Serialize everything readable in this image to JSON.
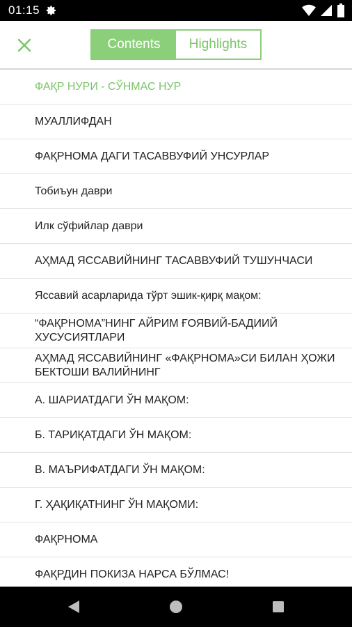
{
  "status_bar": {
    "time": "01:15",
    "icons": [
      "gear-icon",
      "wifi-icon",
      "signal-icon",
      "battery-icon"
    ]
  },
  "app_bar": {
    "close_icon": "close-icon",
    "tabs": [
      {
        "label": "Contents",
        "active": true
      },
      {
        "label": "Highlights",
        "active": false
      }
    ]
  },
  "colors": {
    "accent": "#8bcf7a",
    "accent_text": "#7cc46a"
  },
  "contents": [
    {
      "title": "ФАҚР НУРИ - СЎНМАС НУР",
      "current": true
    },
    {
      "title": "МУАЛЛИФДАН",
      "current": false
    },
    {
      "title": "ФАҚРНОМА ДАГИ ТАСАВВУФИЙ УНСУРЛАР",
      "current": false
    },
    {
      "title": "Тобиъун даври",
      "current": false
    },
    {
      "title": "Илк сўфийлар даври",
      "current": false
    },
    {
      "title": "АҲМАД ЯССАВИЙНИНГ ТАСАВВУФИЙ ТУШУНЧАСИ",
      "current": false
    },
    {
      "title": "Яссавий асарларида тўрт эшик-қирқ мақом:",
      "current": false
    },
    {
      "title": "“ФАҚРНОМА”НИНГ АЙРИМ ҒОЯВИЙ-БАДИИЙ ХУСУСИЯТЛАРИ",
      "current": false
    },
    {
      "title": "АҲМАД ЯССАВИЙНИНГ «ФАҚРНОМА»СИ БИЛАН ҲОЖИ БЕКТОШИ ВАЛИЙНИНГ",
      "current": false
    },
    {
      "title": "А. ШАРИАТДАГИ ЎН МАҚОМ:",
      "current": false
    },
    {
      "title": "Б. ТАРИҚАТДАГИ ЎН МАҚОМ:",
      "current": false
    },
    {
      "title": "В. МАЪРИФАТДАГИ ЎН МАҚОМ:",
      "current": false
    },
    {
      "title": "Г. ҲАҚИҚАТНИНГ ЎН МАҚОМИ:",
      "current": false
    },
    {
      "title": "ФАҚРНОМА",
      "current": false
    },
    {
      "title": "ФАҚРДИН ПОКИЗА НАРСА БЎЛМАС!",
      "current": false
    }
  ],
  "nav_bar": {
    "buttons": [
      "back-icon",
      "home-icon",
      "recents-icon"
    ]
  }
}
